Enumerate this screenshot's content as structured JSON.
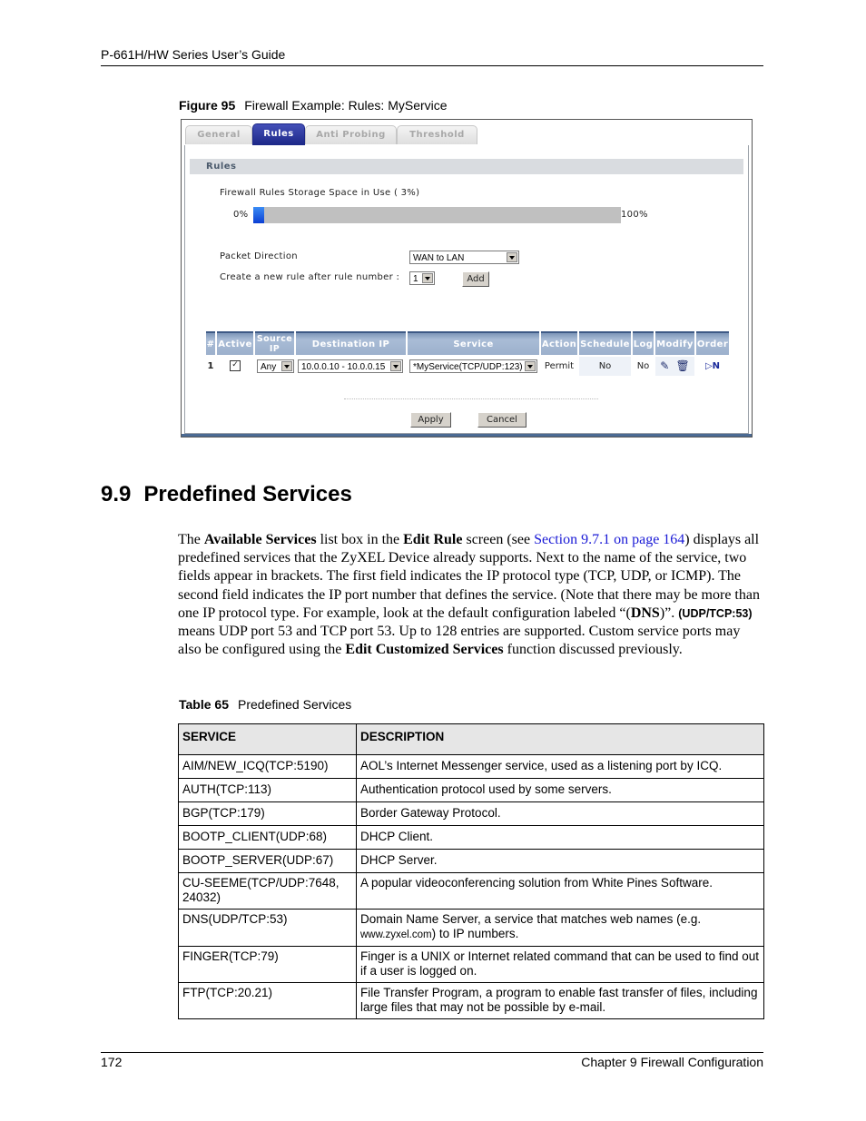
{
  "page_header": "P-661H/HW Series User’s Guide",
  "figure": {
    "label": "Figure 95",
    "title": "Firewall Example: Rules: MyService"
  },
  "screenshot": {
    "tabs": [
      {
        "label": "General",
        "active": false
      },
      {
        "label": "Rules",
        "active": true
      },
      {
        "label": "Anti Probing",
        "active": false
      },
      {
        "label": "Threshold",
        "active": false
      }
    ],
    "section_title": "Rules",
    "storage": {
      "label": "Firewall Rules Storage Space in Use  ( 3%)",
      "min_label": "0%",
      "max_label": "100%",
      "used_percent": 3
    },
    "packet_direction": {
      "label": "Packet Direction",
      "value": "WAN to LAN"
    },
    "new_rule": {
      "label": "Create a new rule after rule number :",
      "value": "1",
      "add_button": "Add"
    },
    "table": {
      "headers": [
        "#",
        "Active",
        "Source IP",
        "Destination IP",
        "Service",
        "Action",
        "Schedule",
        "Log",
        "Modify",
        "Order"
      ],
      "rows": [
        {
          "number": "1",
          "active": true,
          "source_ip": "Any",
          "destination_ip": "10.0.0.10 - 10.0.0.15",
          "service": "*MyService(TCP/UDP:123)",
          "action": "Permit",
          "schedule": "No",
          "log": "No",
          "modify_icons": [
            "edit-icon",
            "delete-icon"
          ],
          "order_icon": "move-icon"
        }
      ]
    },
    "apply_button": "Apply",
    "cancel_button": "Cancel"
  },
  "section": {
    "number": "9.9",
    "title": "Predefined Services"
  },
  "paragraph": {
    "t1": "The ",
    "b1": "Available Services",
    "t2": " list box in the ",
    "b2": "Edit Rule",
    "t3": " screen (see ",
    "link": "Section 9.7.1 on page 164",
    "t4": ") displays all predefined services that the ZyXEL Device already supports. Next to the name of the service, two fields appear in brackets. The first field indicates the IP protocol type (TCP, UDP, or ICMP). The second field indicates the IP port number that defines the service. (Note that there may be more than one IP protocol type. For example, look at the default configuration labeled “(",
    "b3": "DNS",
    "t5": ")”. ",
    "code": "(UDP/TCP:53)",
    "t6": " means UDP port 53 and TCP port 53. Up to 128 entries are supported. Custom service ports may also be configured using the ",
    "b4": "Edit Customized Services",
    "t7": " function discussed previously."
  },
  "table_caption": {
    "label": "Table 65",
    "title": "Predefined Services"
  },
  "services_table": {
    "headers": [
      "SERVICE",
      "DESCRIPTION"
    ],
    "rows": [
      {
        "service": "AIM/NEW_ICQ(TCP:5190)",
        "description": "AOL’s Internet Messenger service, used as a listening port by ICQ."
      },
      {
        "service": "AUTH(TCP:113)",
        "description": "Authentication protocol used by some servers."
      },
      {
        "service": "BGP(TCP:179)",
        "description": "Border Gateway Protocol."
      },
      {
        "service": "BOOTP_CLIENT(UDP:68)",
        "description": "DHCP Client."
      },
      {
        "service": "BOOTP_SERVER(UDP:67)",
        "description": "DHCP Server."
      },
      {
        "service": "CU-SEEME(TCP/UDP:7648, 24032)",
        "description": "A popular videoconferencing solution from White Pines Software."
      },
      {
        "service": "DNS(UDP/TCP:53)",
        "description": "Domain Name Server, a service that matches web names (e.g. ",
        "description_small": "www.zyxel.com",
        "description_end": ") to IP numbers."
      },
      {
        "service": "FINGER(TCP:79)",
        "description": "Finger is a UNIX or Internet related command that can be used to find out if a user is logged on."
      },
      {
        "service": "FTP(TCP:20.21)",
        "description": "File Transfer Program, a program to enable fast transfer of files, including large files that may not be possible by e-mail."
      }
    ]
  },
  "footer": {
    "page_number": "172",
    "chapter": "Chapter 9 Firewall Configuration"
  }
}
